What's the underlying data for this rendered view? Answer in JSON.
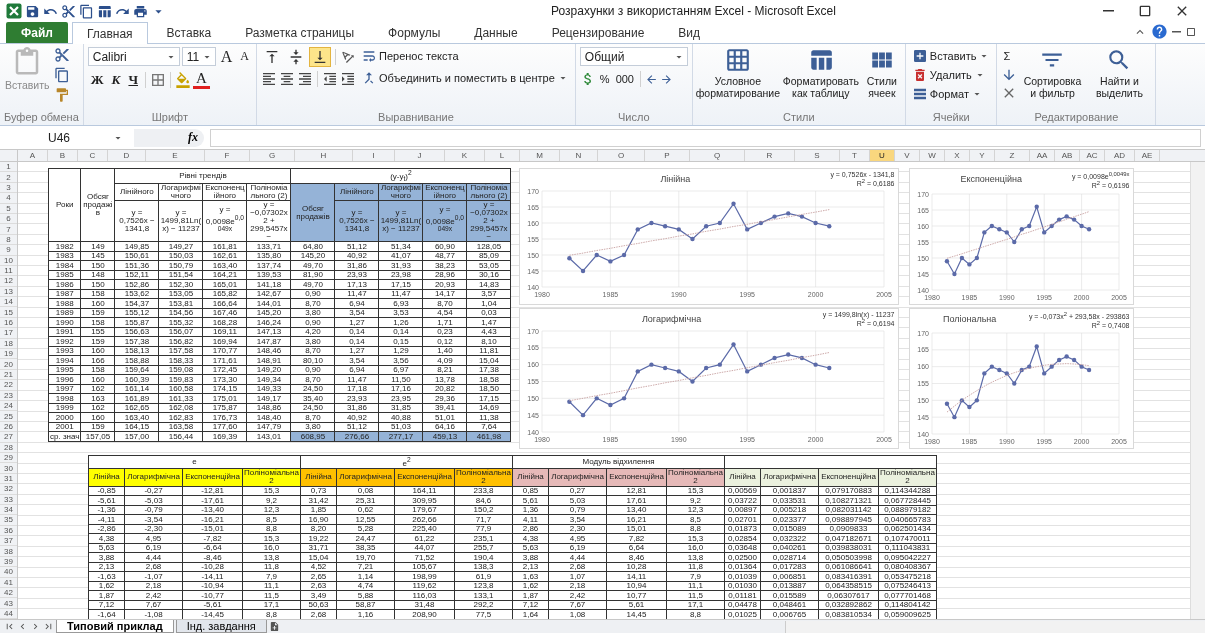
{
  "title_bar": {
    "title": "Розрахунки з використанням Excel  -  Microsoft Excel"
  },
  "ribbon_tabs": [
    {
      "label": "Файл",
      "kind": "file",
      "selected": false
    },
    {
      "label": "Главная",
      "kind": "tab",
      "selected": true
    },
    {
      "label": "Вставка",
      "kind": "tab",
      "selected": false
    },
    {
      "label": "Разметка страницы",
      "kind": "tab",
      "selected": false
    },
    {
      "label": "Формулы",
      "kind": "tab",
      "selected": false
    },
    {
      "label": "Данные",
      "kind": "tab",
      "selected": false
    },
    {
      "label": "Рецензирование",
      "kind": "tab",
      "selected": false
    },
    {
      "label": "Вид",
      "kind": "tab",
      "selected": false
    }
  ],
  "ribbon": {
    "clipboard": {
      "paste": "Вставить",
      "label": "Буфер обмена"
    },
    "font": {
      "name": "Calibri",
      "size": "11",
      "grow": "A",
      "shrink": "A",
      "bold": "Ж",
      "italic": "К",
      "underline": "Ч",
      "color_letter": "A",
      "label": "Шрифт"
    },
    "alignment": {
      "vertical": [
        {
          "selected": false
        },
        {
          "selected": false
        },
        {
          "selected": true
        }
      ],
      "wrap": "Перенос текста",
      "merge": "Объединить и поместить в центре",
      "label": "Выравнивание"
    },
    "number": {
      "format": "Общий",
      "percent": "%",
      "thousands": "000",
      "label": "Число"
    },
    "styles": {
      "buttons": [
        "Условное форматирование",
        "Форматировать как таблицу",
        "Стили ячеек"
      ],
      "label": "Стили"
    },
    "cells": {
      "buttons": [
        "Вставить",
        "Удалить",
        "Формат"
      ],
      "label": "Ячейки"
    },
    "editing": {
      "sum": "Σ",
      "buttons": [
        "Сортировка и фильтр",
        "Найти и выделить"
      ],
      "label": "Редактирование"
    }
  },
  "formula_bar": {
    "name_box": "U46",
    "fx": "fx"
  },
  "column_headers": [
    {
      "label": "A",
      "selected": false
    },
    {
      "label": "B",
      "selected": false
    },
    {
      "label": "C",
      "selected": false
    },
    {
      "label": "D",
      "selected": false
    },
    {
      "label": "E",
      "selected": false
    },
    {
      "label": "F",
      "selected": false
    },
    {
      "label": "G",
      "selected": false
    },
    {
      "label": "H",
      "selected": false
    },
    {
      "label": "I",
      "selected": false
    },
    {
      "label": "J",
      "selected": false
    },
    {
      "label": "K",
      "selected": false
    },
    {
      "label": "L",
      "selected": false
    },
    {
      "label": "M",
      "selected": false
    },
    {
      "label": "N",
      "selected": false
    },
    {
      "label": "O",
      "selected": false
    },
    {
      "label": "P",
      "selected": false
    },
    {
      "label": "Q",
      "selected": false
    },
    {
      "label": "R",
      "selected": false
    },
    {
      "label": "S",
      "selected": false
    },
    {
      "label": "T",
      "selected": false
    },
    {
      "label": "U",
      "selected": true
    },
    {
      "label": "V",
      "selected": false
    },
    {
      "label": "W",
      "selected": false
    },
    {
      "label": "X",
      "selected": false
    },
    {
      "label": "Y",
      "selected": false
    },
    {
      "label": "Z",
      "selected": false
    },
    {
      "label": "AA",
      "selected": false
    },
    {
      "label": "AB",
      "selected": false
    },
    {
      "label": "AC",
      "selected": false
    },
    {
      "label": "AD",
      "selected": false
    },
    {
      "label": "AE",
      "selected": false
    }
  ],
  "row_numbers": [
    "1",
    "2",
    "3",
    "4",
    "5",
    "6",
    "7",
    "8",
    "9",
    "10",
    "11",
    "12",
    "13",
    "14",
    "15",
    "16",
    "17",
    "18",
    "19",
    "20",
    "21",
    "22",
    "23",
    "24",
    "25",
    "26",
    "27",
    "28",
    "29",
    "30",
    "31",
    "32",
    "33",
    "34",
    "35",
    "36",
    "37",
    "38",
    "39",
    "40",
    "41",
    "42",
    "43",
    "44"
  ],
  "trend_table": {
    "year_header": "Роки",
    "volume_header": "Обсяг продажів",
    "level_group": {
      "title": "Рівні трендів",
      "columns": [
        {
          "label": "Лінійного",
          "formula": "y = 0,7526x − 1341,8"
        },
        {
          "label": "Логарифмічного",
          "formula": "y = 1499,81Ln(x) − 11237"
        },
        {
          "label": "Експоненційного",
          "formula": "y = 0,0098e$^{0,0049x}$"
        },
        {
          "label": "Поліноміального (2)",
          "formula": "y = −0,07302x2 + 299,5457x −"
        }
      ]
    },
    "error_group": {
      "title": "(y-y$_{t}$)$^{2}$",
      "color": "#95b3d7",
      "volume_header": "Обсяг продажів",
      "columns": [
        {
          "label": "Лінійного",
          "formula": "y = 0,7526x − 1341,8"
        },
        {
          "label": "Логарифмічного",
          "formula": "y = 1499,81Ln(x) − 11237"
        },
        {
          "label": "Експоненційного",
          "formula": "y = 0,0098e$^{0,0049x}$"
        },
        {
          "label": "Поліноміального (2)",
          "formula": "y = −0,07302x2 + 299,5457x −"
        }
      ]
    },
    "rows": [
      [
        "1982",
        "149",
        "149,85",
        "149,27",
        "161,81",
        "133,71",
        "64,80",
        "51,12",
        "51,34",
        "60,90",
        "128,05"
      ],
      [
        "1983",
        "145",
        "150,61",
        "150,03",
        "162,61",
        "135,80",
        "145,20",
        "40,92",
        "41,07",
        "48,77",
        "85,09"
      ],
      [
        "1984",
        "150",
        "151,36",
        "150,79",
        "163,40",
        "137,74",
        "49,70",
        "31,86",
        "31,93",
        "38,23",
        "53,05"
      ],
      [
        "1985",
        "148",
        "152,11",
        "151,54",
        "164,21",
        "139,53",
        "81,90",
        "23,93",
        "23,98",
        "28,96",
        "30,16"
      ],
      [
        "1986",
        "150",
        "152,86",
        "152,30",
        "165,01",
        "141,18",
        "49,70",
        "17,13",
        "17,15",
        "20,93",
        "14,83"
      ],
      [
        "1987",
        "158",
        "153,62",
        "153,05",
        "165,82",
        "142,67",
        "0,90",
        "11,47",
        "11,47",
        "14,17",
        "3,57"
      ],
      [
        "1988",
        "160",
        "154,37",
        "153,81",
        "166,64",
        "144,01",
        "8,70",
        "6,94",
        "6,93",
        "8,70",
        "1,04"
      ],
      [
        "1989",
        "159",
        "155,12",
        "154,56",
        "167,46",
        "145,20",
        "3,80",
        "3,54",
        "3,53",
        "4,54",
        "0,03"
      ],
      [
        "1990",
        "158",
        "155,87",
        "155,32",
        "168,28",
        "146,24",
        "0,90",
        "1,27",
        "1,26",
        "1,71",
        "1,47"
      ],
      [
        "1991",
        "155",
        "156,63",
        "156,07",
        "169,11",
        "147,13",
        "4,20",
        "0,14",
        "0,14",
        "0,23",
        "4,43"
      ],
      [
        "1992",
        "159",
        "157,38",
        "156,82",
        "169,94",
        "147,87",
        "3,80",
        "0,14",
        "0,15",
        "0,12",
        "8,10"
      ],
      [
        "1993",
        "160",
        "158,13",
        "157,58",
        "170,77",
        "148,46",
        "8,70",
        "1,27",
        "1,29",
        "1,40",
        "11,81"
      ],
      [
        "1994",
        "166",
        "158,88",
        "158,33",
        "171,61",
        "148,91",
        "80,10",
        "3,54",
        "3,56",
        "4,09",
        "15,04"
      ],
      [
        "1995",
        "158",
        "159,64",
        "159,08",
        "172,45",
        "149,20",
        "0,90",
        "6,94",
        "6,97",
        "8,21",
        "17,38"
      ],
      [
        "1996",
        "160",
        "160,39",
        "159,83",
        "173,30",
        "149,34",
        "8,70",
        "11,47",
        "11,50",
        "13,78",
        "18,58"
      ],
      [
        "1997",
        "162",
        "161,14",
        "160,58",
        "174,15",
        "149,33",
        "24,50",
        "17,18",
        "17,16",
        "20,82",
        "18,50"
      ],
      [
        "1998",
        "163",
        "161,89",
        "161,33",
        "175,01",
        "149,17",
        "35,40",
        "23,93",
        "23,95",
        "29,36",
        "17,15"
      ],
      [
        "1999",
        "162",
        "162,65",
        "162,08",
        "175,87",
        "148,86",
        "24,50",
        "31,86",
        "31,85",
        "39,41",
        "14,69"
      ],
      [
        "2000",
        "160",
        "163,40",
        "162,83",
        "176,73",
        "148,40",
        "8,70",
        "40,92",
        "40,88",
        "51,01",
        "11,38"
      ],
      [
        "2001",
        "159",
        "164,15",
        "163,58",
        "177,60",
        "147,79",
        "3,80",
        "51,12",
        "51,03",
        "64,16",
        "7,64"
      ]
    ],
    "average_row": [
      "ср. знач",
      "157,05",
      "157,00",
      "156,44",
      "169,39",
      "143,01",
      "608,95",
      "276,66",
      "277,17",
      "459,13",
      "461,98"
    ]
  },
  "charts": [
    {
      "equation": "y = 0,7526x - 1341,8",
      "r_squared": "R$^{2}$ = 0,6186",
      "chart_data": {
        "type": "line",
        "title": "Лінійна",
        "grid": true,
        "x": [
          1982,
          1983,
          1984,
          1985,
          1986,
          1987,
          1988,
          1989,
          1990,
          1991,
          1992,
          1993,
          1994,
          1995,
          1996,
          1997,
          1998,
          1999,
          2000,
          2001
        ],
        "xlim": [
          1980,
          2005
        ],
        "ylim": [
          140,
          170
        ],
        "xticks": [
          1980,
          1985,
          1990,
          1995,
          2000,
          2005
        ],
        "yticks": [
          140,
          145,
          150,
          155,
          160,
          165,
          170
        ],
        "series": [
          {
            "line_style": "solid",
            "color": "#5b6aa8",
            "values": [
              149,
              145,
              150,
              148,
              150,
              158,
              160,
              159,
              158,
              155,
              159,
              160,
              166,
              158,
              160,
              162,
              163,
              162,
              160,
              159
            ]
          },
          {
            "line_style": "dashed",
            "color": "#c7a0a0",
            "values": [
              149.9,
              150.6,
              151.4,
              152.1,
              152.9,
              153.6,
              154.4,
              155.1,
              155.9,
              156.6,
              157.4,
              158.1,
              158.9,
              159.6,
              160.4,
              161.1,
              161.9,
              162.7,
              163.4,
              164.2
            ]
          }
        ]
      }
    },
    {
      "equation": "y = 0,0098e$^{0,0049x}$",
      "r_squared": "R$^{2}$ = 0,6196",
      "chart_data": {
        "type": "line",
        "title": "Експоненційна",
        "grid": true,
        "x": [
          1982,
          1983,
          1984,
          1985,
          1986,
          1987,
          1988,
          1989,
          1990,
          1991,
          1992,
          1993,
          1994,
          1995,
          1996,
          1997,
          1998,
          1999,
          2000,
          2001
        ],
        "xlim": [
          1980,
          2005
        ],
        "ylim": [
          140,
          170
        ],
        "xticks": [
          1980,
          1985,
          1990,
          1995,
          2000,
          2005
        ],
        "yticks": [
          140,
          145,
          150,
          155,
          160,
          165,
          170
        ],
        "series": [
          {
            "line_style": "solid",
            "color": "#5b6aa8",
            "values": [
              149,
              145,
              150,
              148,
              150,
              158,
              160,
              159,
              158,
              155,
              159,
              160,
              166,
              158,
              160,
              162,
              163,
              162,
              160,
              159
            ]
          },
          {
            "line_style": "dashed",
            "color": "#c7a0a0",
            "values": [
              149.9,
              150.6,
              151.3,
              152.1,
              152.8,
              153.6,
              154.3,
              155.1,
              155.8,
              156.6,
              157.4,
              158.1,
              158.9,
              159.7,
              160.5,
              161.3,
              162.1,
              162.9,
              163.7,
              164.5
            ]
          }
        ]
      }
    },
    {
      "equation": "y = 1499,8ln(x) - 11237",
      "r_squared": "R$^{2}$ = 0,6194",
      "chart_data": {
        "type": "line",
        "title": "Логарифмічна",
        "grid": true,
        "x": [
          1982,
          1983,
          1984,
          1985,
          1986,
          1987,
          1988,
          1989,
          1990,
          1991,
          1992,
          1993,
          1994,
          1995,
          1996,
          1997,
          1998,
          1999,
          2000,
          2001
        ],
        "xlim": [
          1980,
          2005
        ],
        "ylim": [
          140,
          170
        ],
        "xticks": [
          1980,
          1985,
          1990,
          1995,
          2000,
          2005
        ],
        "yticks": [
          140,
          145,
          150,
          155,
          160,
          165,
          170
        ],
        "series": [
          {
            "line_style": "solid",
            "color": "#5b6aa8",
            "values": [
              149,
              145,
              150,
              148,
              150,
              158,
              160,
              159,
              158,
              155,
              159,
              160,
              166,
              158,
              160,
              162,
              163,
              162,
              160,
              159
            ]
          },
          {
            "line_style": "dashed",
            "color": "#c7a0a0",
            "values": [
              149.3,
              150,
              150.8,
              151.5,
              152.3,
              153.1,
              153.8,
              154.6,
              155.3,
              156.1,
              156.8,
              157.6,
              158.3,
              159.1,
              159.8,
              160.6,
              161.3,
              162.1,
              162.8,
              163.6
            ]
          }
        ]
      }
    },
    {
      "equation": "y = -0,073x$^{2}$ + 293,58x - 293863",
      "r_squared": "R$^{2}$ = 0,7408",
      "chart_data": {
        "type": "line",
        "title": "Поліональна",
        "grid": true,
        "x": [
          1982,
          1983,
          1984,
          1985,
          1986,
          1987,
          1988,
          1989,
          1990,
          1991,
          1992,
          1993,
          1994,
          1995,
          1996,
          1997,
          1998,
          1999,
          2000,
          2001
        ],
        "xlim": [
          1980,
          2005
        ],
        "ylim": [
          140,
          170
        ],
        "xticks": [
          1980,
          1985,
          1990,
          1995,
          2000,
          2005
        ],
        "yticks": [
          140,
          145,
          150,
          155,
          160,
          165,
          170
        ],
        "series": [
          {
            "line_style": "solid",
            "color": "#5b6aa8",
            "values": [
              149,
              145,
              150,
              148,
              150,
              158,
              160,
              159,
              158,
              155,
              159,
              160,
              166,
              158,
              160,
              162,
              163,
              162,
              160,
              159
            ]
          },
          {
            "line_style": "dashed",
            "color": "#c7a0a0",
            "values": [
              146.5,
              148.3,
              150,
              151.5,
              152.9,
              154.2,
              155.4,
              156.4,
              157.4,
              158.2,
              158.9,
              159.5,
              160,
              160.4,
              160.7,
              160.8,
              160.9,
              160.8,
              160.6,
              160.3
            ]
          }
        ]
      }
    }
  ],
  "error_table": {
    "groups": [
      {
        "title": "e",
        "color": "#ffff00",
        "columns": [
          "Лінійна",
          "Логарифмічна",
          "Експоненційна",
          "Поліноміальна 2"
        ]
      },
      {
        "title": "e$^{2}$",
        "color": "#ffc000",
        "columns": [
          "Лінійна",
          "Логарифмічна",
          "Експоненційна",
          "Поліноміальна 2"
        ]
      },
      {
        "title": "Модуль відхилення",
        "color": "#e6b9b8",
        "columns": [
          "Лінійна",
          "Логарифмічна",
          "Експоненційна",
          "Поліноміальна 2"
        ]
      },
      {
        "color": "#ebf1de",
        "columns": [
          "Лінійна",
          "Логарифмічна",
          "Експоненційна",
          "Поліноміальна 2"
        ]
      }
    ],
    "rows": [
      [
        "-0,85",
        "-0,27",
        "-12,81",
        "15,3",
        "0,73",
        "0,08",
        "164,11",
        "233,8",
        "0,85",
        "0,27",
        "12,81",
        "15,3",
        "0,00569",
        "0,001837",
        "0,079170883",
        "0,114344288"
      ],
      [
        "-5,61",
        "-5,03",
        "-17,61",
        "9,2",
        "31,42",
        "25,31",
        "309,95",
        "84,6",
        "5,61",
        "5,03",
        "17,61",
        "9,2",
        "0,03722",
        "0,033531",
        "0,108271321",
        "0,067728445"
      ],
      [
        "-1,36",
        "-0,79",
        "-13,40",
        "12,3",
        "1,85",
        "0,62",
        "179,67",
        "150,2",
        "1,36",
        "0,79",
        "13,40",
        "12,3",
        "0,00897",
        "0,005218",
        "0,082031142",
        "0,088979182"
      ],
      [
        "-4,11",
        "-3,54",
        "-16,21",
        "8,5",
        "16,90",
        "12,55",
        "262,66",
        "71,7",
        "4,11",
        "3,54",
        "16,21",
        "8,5",
        "0,02701",
        "0,023377",
        "0,098897945",
        "0,040665783"
      ],
      [
        "-2,86",
        "-2,30",
        "-15,01",
        "8,8",
        "8,20",
        "5,28",
        "225,40",
        "77,9",
        "2,86",
        "2,30",
        "15,01",
        "8,8",
        "0,01873",
        "0,015089",
        "0,0909833",
        "0,062501434"
      ],
      [
        "4,38",
        "4,95",
        "-7,82",
        "15,3",
        "19,22",
        "24,47",
        "61,22",
        "235,1",
        "4,38",
        "4,95",
        "7,82",
        "15,3",
        "0,02854",
        "0,032322",
        "0,047182671",
        "0,107470011"
      ],
      [
        "5,63",
        "6,19",
        "-6,64",
        "16,0",
        "31,71",
        "38,35",
        "44,07",
        "255,7",
        "5,63",
        "6,19",
        "6,64",
        "16,0",
        "0,03648",
        "0,040261",
        "0,039838031",
        "0,111043831"
      ],
      [
        "3,88",
        "4,44",
        "-8,46",
        "13,8",
        "15,04",
        "19,70",
        "71,52",
        "190,4",
        "3,88",
        "4,44",
        "8,46",
        "13,8",
        "0,02500",
        "0,028714",
        "0,050503998",
        "0,095042227"
      ],
      [
        "2,13",
        "2,68",
        "-10,28",
        "11,8",
        "4,52",
        "7,21",
        "105,67",
        "138,3",
        "2,13",
        "2,68",
        "10,28",
        "11,8",
        "0,01364",
        "0,017283",
        "0,061086641",
        "0,080408367"
      ],
      [
        "-1,63",
        "-1,07",
        "-14,11",
        "7,9",
        "2,65",
        "1,14",
        "198,99",
        "61,9",
        "1,63",
        "1,07",
        "14,11",
        "7,9",
        "0,01039",
        "0,006851",
        "0,083416391",
        "0,053475218"
      ],
      [
        "1,62",
        "2,18",
        "-10,94",
        "11,1",
        "2,63",
        "4,74",
        "119,62",
        "123,8",
        "1,62",
        "2,18",
        "10,94",
        "11,1",
        "0,01030",
        "0,013887",
        "0,064358515",
        "0,075246413"
      ],
      [
        "1,87",
        "2,42",
        "-10,77",
        "11,5",
        "3,49",
        "5,88",
        "116,03",
        "133,1",
        "1,87",
        "2,42",
        "10,77",
        "11,5",
        "0,01181",
        "0,015589",
        "0,06307617",
        "0,077701468"
      ],
      [
        "7,12",
        "7,67",
        "-5,61",
        "17,1",
        "50,63",
        "58,87",
        "31,48",
        "292,2",
        "7,12",
        "7,67",
        "5,61",
        "17,1",
        "0,04478",
        "0,048461",
        "0,032892862",
        "0,114804142"
      ],
      [
        "-1,64",
        "-1,08",
        "-14,45",
        "8,8",
        "2,68",
        "1,16",
        "208,90",
        "77,5",
        "1,64",
        "1,08",
        "14,45",
        "8,8",
        "0,01025",
        "0,006765",
        "0,083810534",
        "0,059009625"
      ]
    ]
  },
  "sheet_tabs": [
    {
      "label": "Типовий приклад",
      "selected": true
    },
    {
      "label": "Інд. завдання",
      "selected": false
    }
  ]
}
